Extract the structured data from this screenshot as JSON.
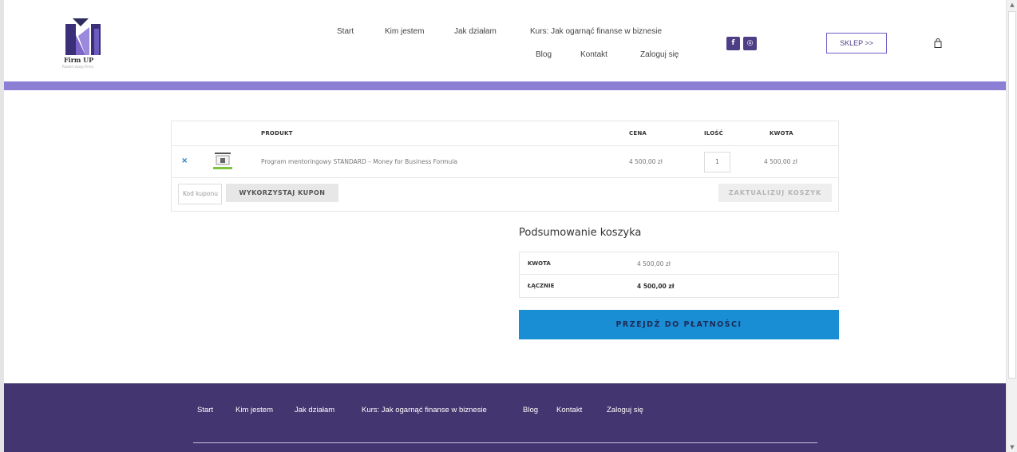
{
  "header": {
    "logo_name": "Firm UP",
    "logo_sub": "Rozwiń swoją Firmę",
    "nav": [
      "Start",
      "Kim jestem",
      "Jak działam",
      "Kurs: Jak ogarnąć finanse w biznesie",
      "Blog",
      "Kontakt",
      "Zaloguj się"
    ],
    "social": [
      "f",
      "◎"
    ],
    "shop_button": "SKLEP >>",
    "cart_icon": "shopping-bag-icon"
  },
  "cart": {
    "columns": {
      "product": "PRODUKT",
      "price": "CENA",
      "quantity": "ILOŚĆ",
      "amount": "KWOTA"
    },
    "item": {
      "remove": "×",
      "name": "Program mentoringowy STANDARD – Money for Business Formula",
      "price": "4 500,00 zł",
      "quantity": "1",
      "amount": "4 500,00 zł"
    },
    "coupon_placeholder": "Kod kuponu",
    "coupon_button": "WYKORZYSTAJ KUPON",
    "update_button": "ZAKTUALIZUJ KOSZYK"
  },
  "totals": {
    "title": "Podsumowanie koszyka",
    "subtotal_label": "KWOTA",
    "subtotal_value": "4 500,00 zł",
    "total_label": "ŁĄCZNIE",
    "total_value": "4 500,00 zł",
    "checkout_button": "PRZEJDŹ DO PŁATNOŚCI"
  },
  "footer": {
    "nav": [
      "Start",
      "Kim jestem",
      "Jak działam",
      "Kurs: Jak ogarnąć finanse w biznesie",
      "Blog",
      "Kontakt",
      "Zaloguj się"
    ]
  },
  "colors": {
    "brand_purple": "#43356f",
    "stripe": "#8a7fd5",
    "checkout_blue": "#1a8ed5"
  }
}
